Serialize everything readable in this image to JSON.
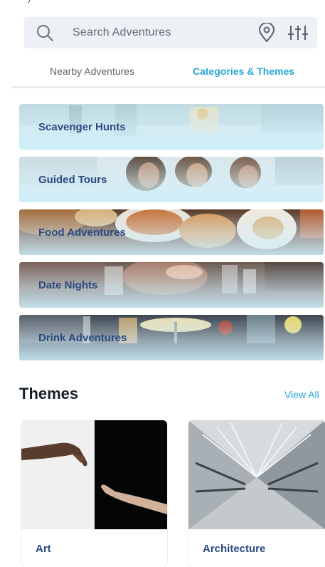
{
  "search": {
    "placeholder": "Search Adventures",
    "icons": [
      "search-icon",
      "location-pin-icon",
      "filter-sliders-icon"
    ]
  },
  "tabs": [
    {
      "label": "Nearby Adventures",
      "active": false
    },
    {
      "label": "Categories & Themes",
      "active": true
    }
  ],
  "categories": [
    {
      "label": "Scavenger Hunts"
    },
    {
      "label": "Guided Tours"
    },
    {
      "label": "Food Adventures"
    },
    {
      "label": "Date Nights"
    },
    {
      "label": "Drink Adventures"
    }
  ],
  "themes": {
    "title": "Themes",
    "view_all": "View All",
    "items": [
      {
        "label": "Art"
      },
      {
        "label": "Architecture"
      }
    ]
  },
  "colors": {
    "accent": "#29a7d8",
    "label_navy": "#2c4a82",
    "search_bg": "#edf0f5"
  }
}
